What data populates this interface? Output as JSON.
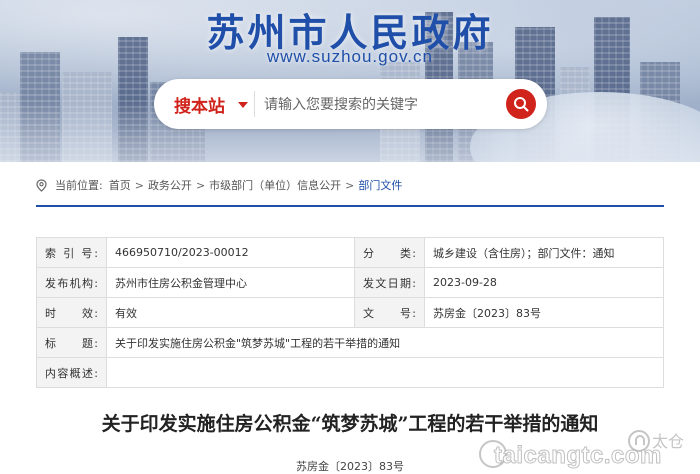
{
  "header": {
    "site_title": "苏州市人民政府",
    "site_url": "www.suzhou.gov.cn"
  },
  "search": {
    "scope_label": "搜本站",
    "placeholder": "请输入您要搜索的关键字"
  },
  "breadcrumb": {
    "label": "当前位置:",
    "items": [
      "首页",
      "政务公开",
      "市级部门（单位）信息公开",
      "部门文件"
    ]
  },
  "info": {
    "index_no_label": "索 引 号:",
    "index_no_value": "466950710/2023-00012",
    "category_label": "分　　类:",
    "category_value": "城乡建设（含住房）；部门文件：通知",
    "issuer_label": "发布机构:",
    "issuer_value": "苏州市住房公积金管理中心",
    "date_label": "发文日期:",
    "date_value": "2023-09-28",
    "validity_label": "时　　效:",
    "validity_value": "有效",
    "doc_no_label": "文　　号:",
    "doc_no_value": "苏房金〔2023〕83号",
    "title_label": "标　　题:",
    "title_value": "关于印发实施住房公积金\"筑梦苏城\"工程的若干举措的通知",
    "summary_label": "内容概述:",
    "summary_value": ""
  },
  "document": {
    "title": "关于印发实施住房公积金“筑梦苏城”工程的若干举措的通知",
    "doc_number": "苏房金〔2023〕83号"
  },
  "watermark": {
    "brand_cn": "太仓",
    "brand_url": "taicangtc.com"
  },
  "colors": {
    "brand_blue": "#1f4fa8",
    "accent_red": "#d0231b"
  }
}
